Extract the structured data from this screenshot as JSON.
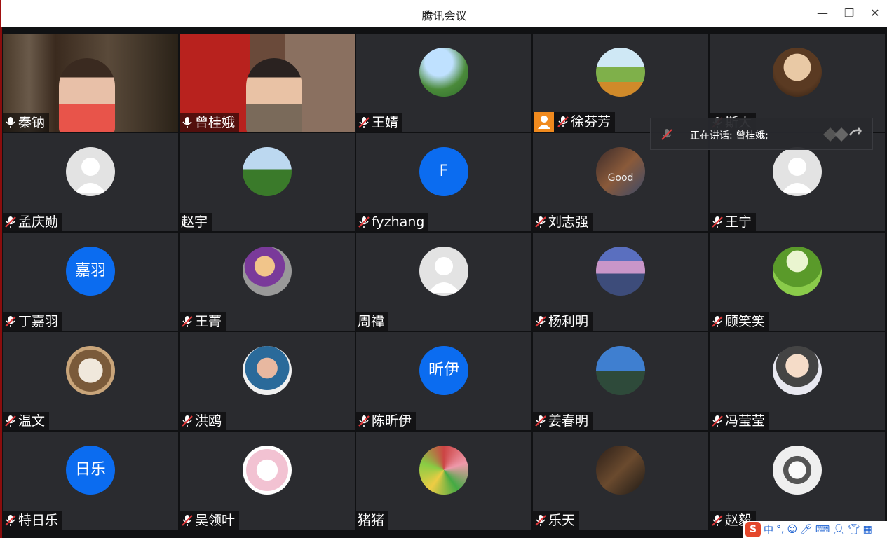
{
  "window": {
    "title": "腾讯会议"
  },
  "speaking_banner": {
    "text": "正在讲话: 曾桂娥;"
  },
  "participants": [
    {
      "name": "秦钠",
      "mic": "on"
    },
    {
      "name": "曾桂娥",
      "mic": "on"
    },
    {
      "name": "王婧",
      "mic": "off"
    },
    {
      "name": "徐芬芳",
      "mic": "off",
      "badge": "person-icon"
    },
    {
      "name": "斯大",
      "mic": "off"
    },
    {
      "name": "孟庆勋",
      "mic": "off"
    },
    {
      "name": "赵宇",
      "mic": "none"
    },
    {
      "name": "fyzhang",
      "mic": "off",
      "avatar_text": "F"
    },
    {
      "name": "刘志强",
      "mic": "off",
      "avatar_caption": "Good"
    },
    {
      "name": "王宁",
      "mic": "off"
    },
    {
      "name": "丁嘉羽",
      "mic": "off",
      "avatar_text": "嘉羽"
    },
    {
      "name": "王菁",
      "mic": "off"
    },
    {
      "name": "周禕",
      "mic": "none"
    },
    {
      "name": "杨利明",
      "mic": "off"
    },
    {
      "name": "顾笑笑",
      "mic": "off"
    },
    {
      "name": "温文",
      "mic": "off"
    },
    {
      "name": "洪鸥",
      "mic": "off"
    },
    {
      "name": "陈昕伊",
      "mic": "off",
      "avatar_text": "昕伊"
    },
    {
      "name": "姜春明",
      "mic": "off"
    },
    {
      "name": "冯莹莹",
      "mic": "off"
    },
    {
      "name": "特日乐",
      "mic": "off",
      "avatar_text": "日乐"
    },
    {
      "name": "吴领叶",
      "mic": "off"
    },
    {
      "name": "猪猪",
      "mic": "none"
    },
    {
      "name": "乐天",
      "mic": "off"
    },
    {
      "name": "赵毅",
      "mic": "off"
    }
  ],
  "tray": {
    "ime": "中",
    "punct": "°,"
  },
  "colors": {
    "accent": "#0b6cf0",
    "active_border": "#39c16a",
    "muted": "#e0393b"
  }
}
